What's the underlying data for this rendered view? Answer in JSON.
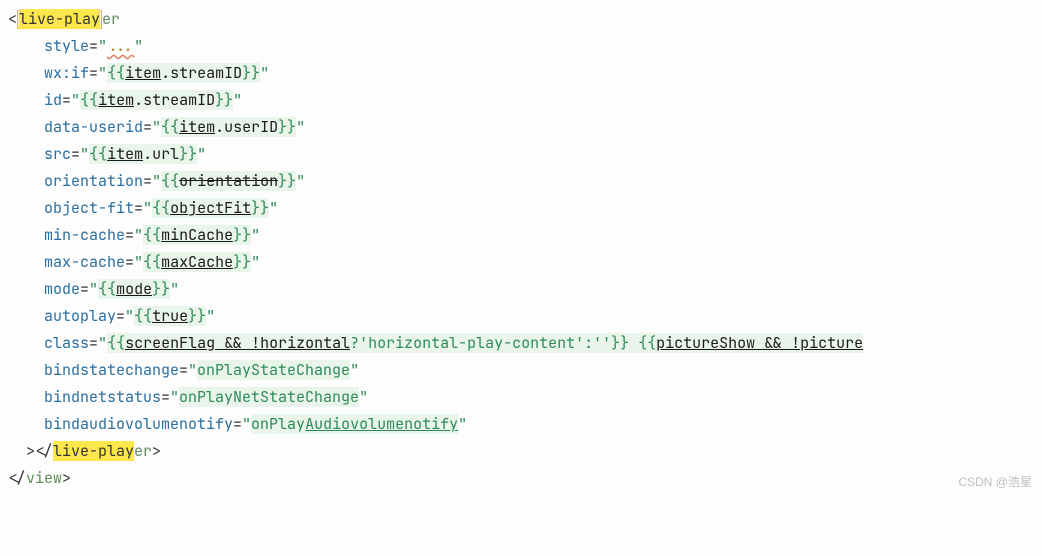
{
  "code": {
    "tag": {
      "highlight": "live-play",
      "rest": "er"
    },
    "attrs": {
      "style": {
        "name": "style",
        "value": "..."
      },
      "wxif": {
        "name": "wx:if",
        "prefix": "{{",
        "obj": "item",
        "prop": "streamID",
        "suffix": "}}"
      },
      "id": {
        "name": "id",
        "prefix": "{{",
        "obj": "item",
        "prop": "streamID",
        "suffix": "}}"
      },
      "userid": {
        "name": "data-userid",
        "prefix": "{{",
        "obj": "item",
        "prop": "userID",
        "suffix": "}}"
      },
      "src": {
        "name": "src",
        "prefix": "{{",
        "obj": "item",
        "prop": "url",
        "suffix": "}}"
      },
      "orientation": {
        "name": "orientation",
        "prefix": "{{",
        "var": "orientation",
        "suffix": "}}"
      },
      "objectfit": {
        "name": "object-fit",
        "prefix": "{{",
        "var": "objectFit",
        "suffix": "}}"
      },
      "mincache": {
        "name": "min-cache",
        "prefix": "{{",
        "var": "minCache",
        "suffix": "}}"
      },
      "maxcache": {
        "name": "max-cache",
        "prefix": "{{",
        "var": "maxCache",
        "suffix": "}}"
      },
      "mode": {
        "name": "mode",
        "prefix": "{{",
        "var": "mode",
        "suffix": "}}"
      },
      "autoplay": {
        "name": "autoplay",
        "prefix": "{{",
        "var": "true",
        "suffix": "}}"
      },
      "class": {
        "name": "class",
        "p1": "{{",
        "cond1": "screenFlag && !horizontal",
        "p2": "?",
        "lit1": "'horizontal-play-content'",
        "p3": ":",
        "lit2": "''",
        "p4": "}} {{",
        "cond2a": "pictureShow && !",
        "cond2b": "picture"
      },
      "bindstate": {
        "name": "bindstatechange",
        "value": "onPlayStateChange"
      },
      "bindnet": {
        "name": "bindnetstatus",
        "value": "onPlayNetStateChange"
      },
      "bindaudio": {
        "name": "bindaudiovolumenotify",
        "value1": "onPlay",
        "value2": "Audiovolumenotify"
      }
    },
    "closeTag": {
      "highlight": "live-play",
      "rest": "er"
    },
    "outerClose": "view"
  },
  "watermark": "CSDN @浩星"
}
